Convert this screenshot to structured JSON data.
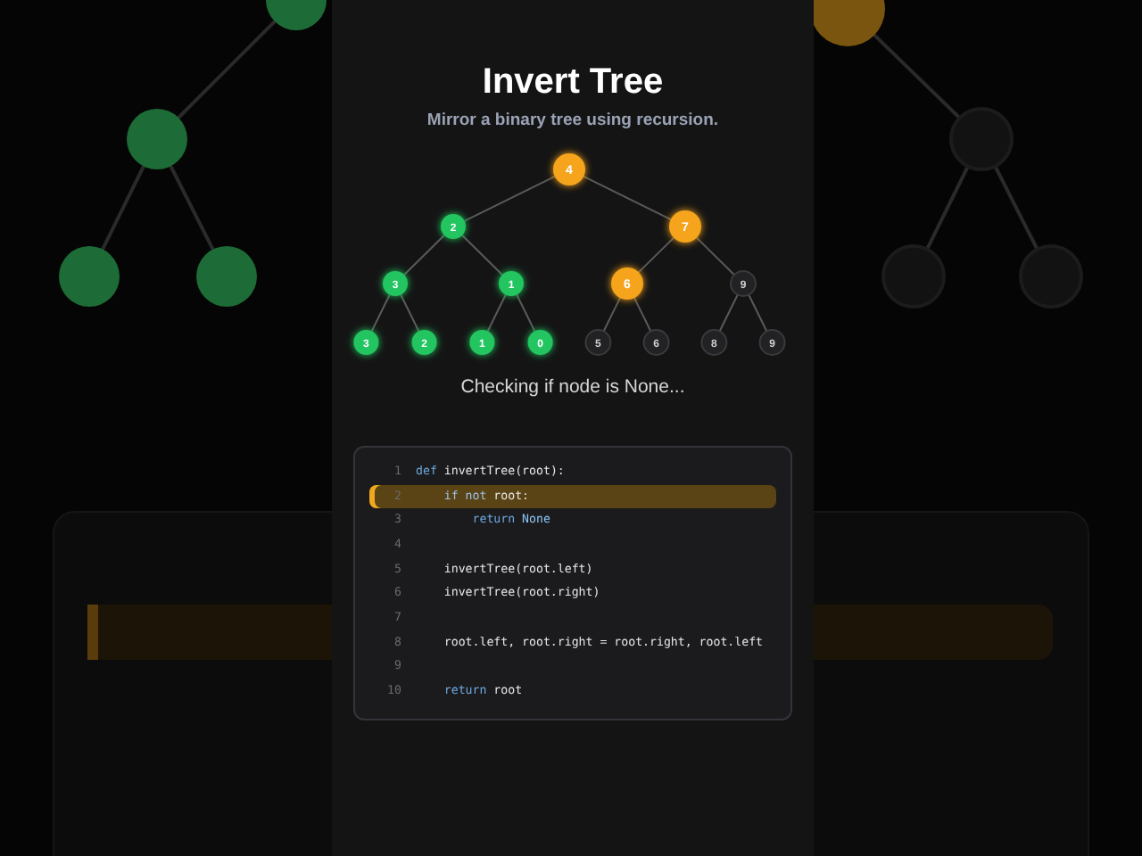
{
  "title": "Invert Tree",
  "subtitle": "Mirror a binary tree using recursion.",
  "tree": {
    "value": "4",
    "color": "#f5a41c",
    "highlighted": true,
    "children": [
      {
        "value": "2",
        "color": "#22c55e",
        "highlighted": false,
        "children": [
          {
            "value": "3",
            "color": "#22c55e",
            "highlighted": false,
            "children": [
              {
                "value": "3",
                "color": "#22c55e",
                "highlighted": false
              },
              {
                "value": "2",
                "color": "#22c55e",
                "highlighted": false
              }
            ]
          },
          {
            "value": "1",
            "color": "#22c55e",
            "highlighted": false,
            "children": [
              {
                "value": "1",
                "color": "#22c55e",
                "highlighted": false
              },
              {
                "value": "0",
                "color": "#22c55e",
                "highlighted": false
              }
            ]
          }
        ]
      },
      {
        "value": "7",
        "color": "#f5a41c",
        "highlighted": true,
        "children": [
          {
            "value": "6",
            "color": "#f5a41c",
            "highlighted": true,
            "children": [
              {
                "value": "5",
                "color": "#222224",
                "highlighted": false
              },
              {
                "value": "6",
                "color": "#222224",
                "highlighted": false
              }
            ]
          },
          {
            "value": "9",
            "color": "#222224",
            "highlighted": false,
            "children": [
              {
                "value": "8",
                "color": "#222224",
                "highlighted": false
              },
              {
                "value": "9",
                "color": "#222224",
                "highlighted": false
              }
            ]
          }
        ]
      }
    ]
  },
  "status": "Checking if node is None...",
  "code": [
    {
      "number": "1",
      "highlighted": false,
      "tokens": [
        {
          "text": "def",
          "kind": "keyword"
        },
        {
          "text": " invertTree(root):",
          "kind": "plain"
        }
      ]
    },
    {
      "number": "2",
      "highlighted": true,
      "tokens": [
        {
          "text": "    if not",
          "kind": "keyword"
        },
        {
          "text": " root:",
          "kind": "plain"
        }
      ]
    },
    {
      "number": "3",
      "highlighted": false,
      "tokens": [
        {
          "text": "        return",
          "kind": "keyword"
        },
        {
          "text": " None",
          "kind": "constant"
        }
      ]
    },
    {
      "number": "4",
      "highlighted": false
    },
    {
      "number": "5",
      "highlighted": false,
      "tokens": [
        {
          "text": "    invertTree(root.left)",
          "kind": "plain"
        }
      ]
    },
    {
      "number": "6",
      "highlighted": false,
      "tokens": [
        {
          "text": "    invertTree(root.right)",
          "kind": "plain"
        }
      ]
    },
    {
      "number": "7",
      "highlighted": false
    },
    {
      "number": "8",
      "highlighted": false,
      "tokens": [
        {
          "text": "    root.left, root.right = root.right, root.left",
          "kind": "plain"
        }
      ]
    },
    {
      "number": "9",
      "highlighted": false
    },
    {
      "number": "10",
      "highlighted": false,
      "tokens": [
        {
          "text": "    return",
          "kind": "keyword"
        },
        {
          "text": " root",
          "kind": "plain"
        }
      ]
    }
  ]
}
